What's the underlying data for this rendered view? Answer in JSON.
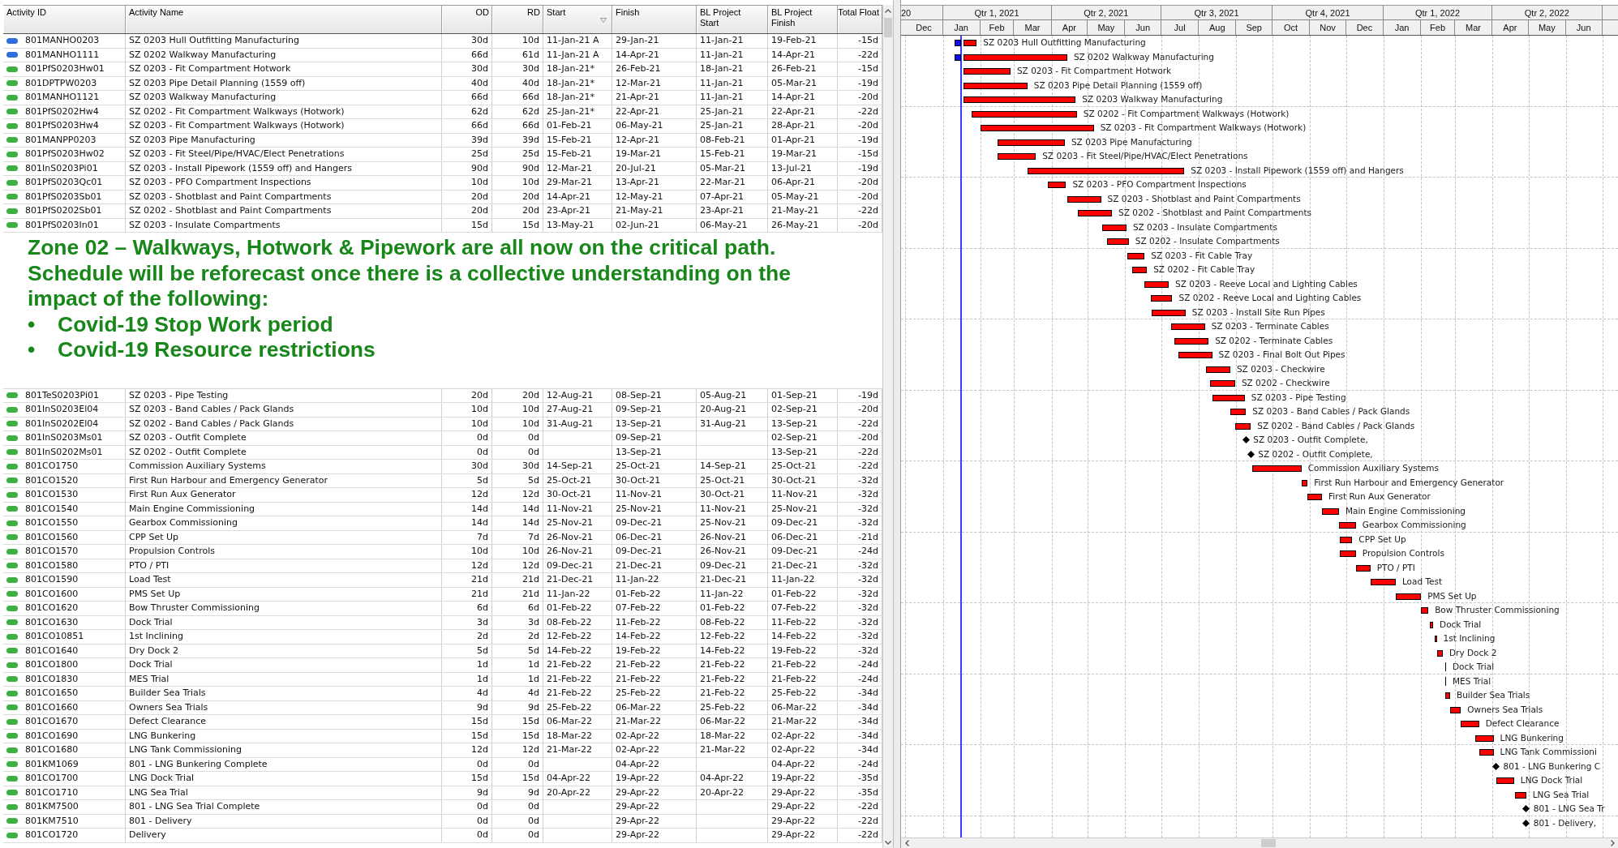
{
  "table": {
    "columns": [
      "Activity ID",
      "Activity Name",
      "OD",
      "RD",
      "Start",
      "Finish",
      "BL Project Start",
      "BL Project Finish",
      "Total Float"
    ],
    "rows_before_callout": [
      {
        "color": "#2f6fdc",
        "id": "801MANHO0203",
        "name": "SZ 0203 Hull Outfitting Manufacturing",
        "od": "30d",
        "rd": "10d",
        "start": "11-Jan-21 A",
        "finish": "29-Jan-21",
        "bl_start": "11-Jan-21",
        "bl_finish": "19-Feb-21",
        "total_float": "-15d"
      },
      {
        "color": "#2f6fdc",
        "id": "801MANHO1111",
        "name": "SZ 0202 Walkway Manufacturing",
        "od": "66d",
        "rd": "61d",
        "start": "11-Jan-21 A",
        "finish": "14-Apr-21",
        "bl_start": "11-Jan-21",
        "bl_finish": "14-Apr-21",
        "total_float": "-22d"
      },
      {
        "color": "#3cb043",
        "id": "801PfS0203Hw01",
        "name": "SZ 0203 - Fit Compartment Hotwork",
        "od": "30d",
        "rd": "30d",
        "start": "18-Jan-21*",
        "finish": "26-Feb-21",
        "bl_start": "18-Jan-21",
        "bl_finish": "26-Feb-21",
        "total_float": "-15d"
      },
      {
        "color": "#3cb043",
        "id": "801DPTPW0203",
        "name": "SZ 0203 Pipe Detail Planning (1559 off)",
        "od": "40d",
        "rd": "40d",
        "start": "18-Jan-21*",
        "finish": "12-Mar-21",
        "bl_start": "11-Jan-21",
        "bl_finish": "05-Mar-21",
        "total_float": "-19d"
      },
      {
        "color": "#3cb043",
        "id": "801MANHO1121",
        "name": "SZ 0203 Walkway Manufacturing",
        "od": "66d",
        "rd": "66d",
        "start": "18-Jan-21*",
        "finish": "21-Apr-21",
        "bl_start": "11-Jan-21",
        "bl_finish": "14-Apr-21",
        "total_float": "-20d"
      },
      {
        "color": "#3cb043",
        "id": "801PfS0202Hw4",
        "name": "SZ 0202 - Fit Compartment Walkways (Hotwork)",
        "od": "62d",
        "rd": "62d",
        "start": "25-Jan-21*",
        "finish": "22-Apr-21",
        "bl_start": "25-Jan-21",
        "bl_finish": "22-Apr-21",
        "total_float": "-22d"
      },
      {
        "color": "#3cb043",
        "id": "801PfS0203Hw4",
        "name": "SZ 0203 - Fit Compartment Walkways (Hotwork)",
        "od": "66d",
        "rd": "66d",
        "start": "01-Feb-21",
        "finish": "06-May-21",
        "bl_start": "25-Jan-21",
        "bl_finish": "28-Apr-21",
        "total_float": "-20d"
      },
      {
        "color": "#3cb043",
        "id": "801MANPP0203",
        "name": "SZ 0203 Pipe Manufacturing",
        "od": "39d",
        "rd": "39d",
        "start": "15-Feb-21",
        "finish": "12-Apr-21",
        "bl_start": "08-Feb-21",
        "bl_finish": "01-Apr-21",
        "total_float": "-19d"
      },
      {
        "color": "#3cb043",
        "id": "801PfS0203Hw02",
        "name": "SZ 0203 - Fit Steel/Pipe/HVAC/Elect Penetrations",
        "od": "25d",
        "rd": "25d",
        "start": "15-Feb-21",
        "finish": "19-Mar-21",
        "bl_start": "15-Feb-21",
        "bl_finish": "19-Mar-21",
        "total_float": "-15d"
      },
      {
        "color": "#3cb043",
        "id": "801InS0203Pi01",
        "name": "SZ 0203 - Install Pipework (1559 off) and Hangers",
        "od": "90d",
        "rd": "90d",
        "start": "12-Mar-21",
        "finish": "20-Jul-21",
        "bl_start": "05-Mar-21",
        "bl_finish": "13-Jul-21",
        "total_float": "-19d"
      },
      {
        "color": "#3cb043",
        "id": "801PfS0203Qc01",
        "name": "SZ 0203 - PFO Compartment Inspections",
        "od": "10d",
        "rd": "10d",
        "start": "29-Mar-21",
        "finish": "13-Apr-21",
        "bl_start": "22-Mar-21",
        "bl_finish": "06-Apr-21",
        "total_float": "-20d"
      },
      {
        "color": "#3cb043",
        "id": "801PfS0203Sb01",
        "name": "SZ 0203 - Shotblast and Paint Compartments",
        "od": "20d",
        "rd": "20d",
        "start": "14-Apr-21",
        "finish": "12-May-21",
        "bl_start": "07-Apr-21",
        "bl_finish": "05-May-21",
        "total_float": "-20d"
      },
      {
        "color": "#3cb043",
        "id": "801PfS0202Sb01",
        "name": "SZ 0202 - Shotblast and Paint Compartments",
        "od": "20d",
        "rd": "20d",
        "start": "23-Apr-21",
        "finish": "21-May-21",
        "bl_start": "23-Apr-21",
        "bl_finish": "21-May-21",
        "total_float": "-22d"
      },
      {
        "color": "#3cb043",
        "id": "801PfS0203In01",
        "name": "SZ 0203 - Insulate Compartments",
        "od": "15d",
        "rd": "15d",
        "start": "13-May-21",
        "finish": "02-Jun-21",
        "bl_start": "06-May-21",
        "bl_finish": "26-May-21",
        "total_float": "-20d"
      }
    ],
    "callout": {
      "text": "Zone 02 – Walkways, Hotwork & Pipework are all now on the critical path. Schedule will be reforecast once there is a collective understanding on the impact of the following:",
      "bullets": [
        {
          "marker": "•",
          "text": "Covid-19 Stop Work period"
        },
        {
          "marker": "•",
          "text": "Covid-19 Resource restrictions"
        }
      ]
    },
    "rows_after_callout": [
      {
        "color": "#3cb043",
        "id": "801TeS0203Pi01",
        "name": "SZ 0203 - Pipe Testing",
        "od": "20d",
        "rd": "20d",
        "start": "12-Aug-21",
        "finish": "08-Sep-21",
        "bl_start": "05-Aug-21",
        "bl_finish": "01-Sep-21",
        "total_float": "-19d"
      },
      {
        "color": "#3cb043",
        "id": "801InS0203El04",
        "name": "SZ 0203 - Band Cables / Pack Glands",
        "od": "10d",
        "rd": "10d",
        "start": "27-Aug-21",
        "finish": "09-Sep-21",
        "bl_start": "20-Aug-21",
        "bl_finish": "02-Sep-21",
        "total_float": "-20d"
      },
      {
        "color": "#3cb043",
        "id": "801InS0202El04",
        "name": "SZ 0202 - Band Cables / Pack Glands",
        "od": "10d",
        "rd": "10d",
        "start": "31-Aug-21",
        "finish": "13-Sep-21",
        "bl_start": "31-Aug-21",
        "bl_finish": "13-Sep-21",
        "total_float": "-22d"
      },
      {
        "color": "#3cb043",
        "id": "801InS0203Ms01",
        "name": "SZ 0203 - Outfit Complete",
        "od": "0d",
        "rd": "0d",
        "finish": "09-Sep-21",
        "bl_finish": "02-Sep-21",
        "total_float": "-20d"
      },
      {
        "color": "#3cb043",
        "id": "801InS0202Ms01",
        "name": "SZ 0202 - Outfit Complete",
        "od": "0d",
        "rd": "0d",
        "finish": "13-Sep-21",
        "bl_finish": "13-Sep-21",
        "total_float": "-22d"
      },
      {
        "color": "#3cb043",
        "id": "801CO1750",
        "name": "Commission Auxiliary Systems",
        "od": "30d",
        "rd": "30d",
        "start": "14-Sep-21",
        "finish": "25-Oct-21",
        "bl_start": "14-Sep-21",
        "bl_finish": "25-Oct-21",
        "total_float": "-22d"
      },
      {
        "color": "#3cb043",
        "id": "801CO1520",
        "name": "First Run Harbour and Emergency Generator",
        "od": "5d",
        "rd": "5d",
        "start": "25-Oct-21",
        "finish": "30-Oct-21",
        "bl_start": "25-Oct-21",
        "bl_finish": "30-Oct-21",
        "total_float": "-32d"
      },
      {
        "color": "#3cb043",
        "id": "801CO1530",
        "name": "First Run Aux Generator",
        "od": "12d",
        "rd": "12d",
        "start": "30-Oct-21",
        "finish": "11-Nov-21",
        "bl_start": "30-Oct-21",
        "bl_finish": "11-Nov-21",
        "total_float": "-32d"
      },
      {
        "color": "#3cb043",
        "id": "801CO1540",
        "name": "Main Engine Commissioning",
        "od": "14d",
        "rd": "14d",
        "start": "11-Nov-21",
        "finish": "25-Nov-21",
        "bl_start": "11-Nov-21",
        "bl_finish": "25-Nov-21",
        "total_float": "-32d"
      },
      {
        "color": "#3cb043",
        "id": "801CO1550",
        "name": "Gearbox Commissioning",
        "od": "14d",
        "rd": "14d",
        "start": "25-Nov-21",
        "finish": "09-Dec-21",
        "bl_start": "25-Nov-21",
        "bl_finish": "09-Dec-21",
        "total_float": "-32d"
      },
      {
        "color": "#3cb043",
        "id": "801CO1560",
        "name": "CPP Set Up",
        "od": "7d",
        "rd": "7d",
        "start": "26-Nov-21",
        "finish": "06-Dec-21",
        "bl_start": "26-Nov-21",
        "bl_finish": "06-Dec-21",
        "total_float": "-21d"
      },
      {
        "color": "#3cb043",
        "id": "801CO1570",
        "name": "Propulsion Controls",
        "od": "10d",
        "rd": "10d",
        "start": "26-Nov-21",
        "finish": "09-Dec-21",
        "bl_start": "26-Nov-21",
        "bl_finish": "09-Dec-21",
        "total_float": "-24d"
      },
      {
        "color": "#3cb043",
        "id": "801CO1580",
        "name": "PTO / PTI",
        "od": "12d",
        "rd": "12d",
        "start": "09-Dec-21",
        "finish": "21-Dec-21",
        "bl_start": "09-Dec-21",
        "bl_finish": "21-Dec-21",
        "total_float": "-32d"
      },
      {
        "color": "#3cb043",
        "id": "801CO1590",
        "name": "Load Test",
        "od": "21d",
        "rd": "21d",
        "start": "21-Dec-21",
        "finish": "11-Jan-22",
        "bl_start": "21-Dec-21",
        "bl_finish": "11-Jan-22",
        "total_float": "-32d"
      },
      {
        "color": "#3cb043",
        "id": "801CO1600",
        "name": "PMS Set Up",
        "od": "21d",
        "rd": "21d",
        "start": "11-Jan-22",
        "finish": "01-Feb-22",
        "bl_start": "11-Jan-22",
        "bl_finish": "01-Feb-22",
        "total_float": "-32d"
      },
      {
        "color": "#3cb043",
        "id": "801CO1620",
        "name": "Bow Thruster Commissioning",
        "od": "6d",
        "rd": "6d",
        "start": "01-Feb-22",
        "finish": "07-Feb-22",
        "bl_start": "01-Feb-22",
        "bl_finish": "07-Feb-22",
        "total_float": "-32d"
      },
      {
        "color": "#3cb043",
        "id": "801CO1630",
        "name": "Dock Trial",
        "od": "3d",
        "rd": "3d",
        "start": "08-Feb-22",
        "finish": "11-Feb-22",
        "bl_start": "08-Feb-22",
        "bl_finish": "11-Feb-22",
        "total_float": "-32d"
      },
      {
        "color": "#3cb043",
        "id": "801CO10851",
        "name": "1st Inclining",
        "od": "2d",
        "rd": "2d",
        "start": "12-Feb-22",
        "finish": "14-Feb-22",
        "bl_start": "12-Feb-22",
        "bl_finish": "14-Feb-22",
        "total_float": "-32d"
      },
      {
        "color": "#3cb043",
        "id": "801CO1640",
        "name": "Dry Dock 2",
        "od": "5d",
        "rd": "5d",
        "start": "14-Feb-22",
        "finish": "19-Feb-22",
        "bl_start": "14-Feb-22",
        "bl_finish": "19-Feb-22",
        "total_float": "-32d"
      },
      {
        "color": "#3cb043",
        "id": "801CO1800",
        "name": "Dock Trial",
        "od": "1d",
        "rd": "1d",
        "start": "21-Feb-22",
        "finish": "21-Feb-22",
        "bl_start": "21-Feb-22",
        "bl_finish": "21-Feb-22",
        "total_float": "-24d"
      },
      {
        "color": "#3cb043",
        "id": "801CO1830",
        "name": "MES Trial",
        "od": "1d",
        "rd": "1d",
        "start": "21-Feb-22",
        "finish": "21-Feb-22",
        "bl_start": "21-Feb-22",
        "bl_finish": "21-Feb-22",
        "total_float": "-24d"
      },
      {
        "color": "#3cb043",
        "id": "801CO1650",
        "name": "Builder Sea Trials",
        "od": "4d",
        "rd": "4d",
        "start": "21-Feb-22",
        "finish": "25-Feb-22",
        "bl_start": "21-Feb-22",
        "bl_finish": "25-Feb-22",
        "total_float": "-34d"
      },
      {
        "color": "#3cb043",
        "id": "801CO1660",
        "name": "Owners Sea Trials",
        "od": "9d",
        "rd": "9d",
        "start": "25-Feb-22",
        "finish": "06-Mar-22",
        "bl_start": "25-Feb-22",
        "bl_finish": "06-Mar-22",
        "total_float": "-34d"
      },
      {
        "color": "#3cb043",
        "id": "801CO1670",
        "name": "Defect Clearance",
        "od": "15d",
        "rd": "15d",
        "start": "06-Mar-22",
        "finish": "21-Mar-22",
        "bl_start": "06-Mar-22",
        "bl_finish": "21-Mar-22",
        "total_float": "-34d"
      },
      {
        "color": "#3cb043",
        "id": "801CO1690",
        "name": "LNG Bunkering",
        "od": "15d",
        "rd": "15d",
        "start": "18-Mar-22",
        "finish": "02-Apr-22",
        "bl_start": "18-Mar-22",
        "bl_finish": "02-Apr-22",
        "total_float": "-34d"
      },
      {
        "color": "#3cb043",
        "id": "801CO1680",
        "name": "LNG Tank Commissioning",
        "od": "12d",
        "rd": "12d",
        "start": "21-Mar-22",
        "finish": "02-Apr-22",
        "bl_start": "21-Mar-22",
        "bl_finish": "02-Apr-22",
        "total_float": "-34d"
      },
      {
        "color": "#3cb043",
        "id": "801KM1069",
        "name": "801 - LNG Bunkering Complete",
        "od": "0d",
        "rd": "0d",
        "finish": "04-Apr-22",
        "bl_finish": "04-Apr-22",
        "total_float": "-24d"
      },
      {
        "color": "#3cb043",
        "id": "801CO1700",
        "name": "LNG Dock Trial",
        "od": "15d",
        "rd": "15d",
        "start": "04-Apr-22",
        "finish": "19-Apr-22",
        "bl_start": "04-Apr-22",
        "bl_finish": "19-Apr-22",
        "total_float": "-35d"
      },
      {
        "color": "#3cb043",
        "id": "801CO1710",
        "name": "LNG Sea Trial",
        "od": "9d",
        "rd": "9d",
        "start": "20-Apr-22",
        "finish": "29-Apr-22",
        "bl_start": "20-Apr-22",
        "bl_finish": "29-Apr-22",
        "total_float": "-35d"
      },
      {
        "color": "#3cb043",
        "id": "801KM7500",
        "name": "801 - LNG Sea Trial Complete",
        "od": "0d",
        "rd": "0d",
        "finish": "29-Apr-22",
        "bl_finish": "29-Apr-22",
        "total_float": "-22d"
      },
      {
        "color": "#3cb043",
        "id": "801KM7510",
        "name": "801 - Delivery",
        "od": "0d",
        "rd": "0d",
        "finish": "29-Apr-22",
        "bl_finish": "29-Apr-22",
        "total_float": "-22d"
      },
      {
        "color": "#3cb043",
        "id": "801CO1720",
        "name": "Delivery",
        "od": "0d",
        "rd": "0d",
        "finish": "29-Apr-22",
        "bl_finish": "29-Apr-22",
        "total_float": "-22d"
      }
    ]
  },
  "gantt": {
    "quarters": [
      "20",
      "Qtr 1, 2021",
      "Qtr 2, 2021",
      "Qtr 3, 2021",
      "Qtr 4, 2021",
      "Qtr 1, 2022",
      "Qtr 2, 2022"
    ],
    "months": [
      "Dec",
      "Jan",
      "Feb",
      "Mar",
      "Apr",
      "May",
      "Jun",
      "Jul",
      "Aug",
      "Sep",
      "Oct",
      "Nov",
      "Dec",
      "Jan",
      "Feb",
      "Mar",
      "Apr",
      "May",
      "Jun"
    ],
    "rows": [
      {
        "kind": "bar",
        "started": true,
        "label": "SZ 0203 Hull Outfitting Manufacturing"
      },
      {
        "kind": "bar",
        "started": true,
        "label": "SZ 0202 Walkway Manufacturing"
      },
      {
        "kind": "bar",
        "started": false,
        "label": "SZ 0203 - Fit Compartment Hotwork"
      },
      {
        "kind": "bar",
        "started": false,
        "label": "SZ 0203 Pipe Detail Planning (1559 off)"
      },
      {
        "kind": "bar",
        "started": false,
        "label": "SZ 0203 Walkway Manufacturing"
      },
      {
        "kind": "bar",
        "started": false,
        "label": "SZ 0202 - Fit Compartment Walkways (Hotwork)"
      },
      {
        "kind": "bar",
        "started": false,
        "label": "SZ 0203 - Fit Compartment Walkways (Hotwork)"
      },
      {
        "kind": "bar",
        "started": false,
        "label": "SZ 0203 Pipe Manufacturing"
      },
      {
        "kind": "bar",
        "started": false,
        "label": "SZ 0203 - Fit Steel/Pipe/HVAC/Elect Penetrations"
      },
      {
        "kind": "bar",
        "started": false,
        "label": "SZ 0203 - Install Pipework (1559 off) and Hangers"
      },
      {
        "kind": "bar",
        "started": false,
        "label": "SZ 0203 - PFO Compartment Inspections"
      },
      {
        "kind": "bar",
        "started": false,
        "label": "SZ 0203 - Shotblast and Paint Compartments"
      },
      {
        "kind": "bar",
        "started": false,
        "label": "SZ 0202 - Shotblast and Paint Compartments"
      },
      {
        "kind": "bar",
        "started": false,
        "label": "SZ 0203 - Insulate Compartments"
      },
      {
        "kind": "bar",
        "started": false,
        "label": "SZ 0202 - Insulate Compartments"
      },
      {
        "kind": "bar",
        "started": false,
        "label": "SZ 0203 - Fit Cable Tray"
      },
      {
        "kind": "bar",
        "started": false,
        "label": "SZ 0202 - Fit Cable Tray"
      },
      {
        "kind": "bar",
        "started": false,
        "label": "SZ 0203 - Reeve Local and Lighting Cables"
      },
      {
        "kind": "bar",
        "started": false,
        "label": "SZ 0202 - Reeve Local and Lighting Cables"
      },
      {
        "kind": "bar",
        "started": false,
        "label": "SZ 0203 - Install Site Run Pipes"
      },
      {
        "kind": "bar",
        "started": false,
        "label": "SZ 0203 - Terminate Cables"
      },
      {
        "kind": "bar",
        "started": false,
        "label": "SZ 0202 - Terminate Cables"
      },
      {
        "kind": "bar",
        "started": false,
        "label": "SZ 0203 - Final Bolt Out Pipes"
      },
      {
        "kind": "bar",
        "started": false,
        "label": "SZ 0203 - Checkwire"
      },
      {
        "kind": "bar",
        "started": false,
        "label": "SZ 0202 - Checkwire"
      },
      {
        "kind": "bar",
        "started": false,
        "label": "SZ 0203 - Pipe Testing"
      },
      {
        "kind": "bar",
        "started": false,
        "label": "SZ 0203 - Band Cables / Pack Glands"
      },
      {
        "kind": "bar",
        "started": false,
        "label": "SZ 0202 - Band Cables / Pack Glands"
      },
      {
        "kind": "milestone",
        "started": false,
        "label": "SZ 0203 - Outfit Complete,"
      },
      {
        "kind": "milestone",
        "started": false,
        "label": "SZ 0202 - Outfit Complete,"
      },
      {
        "kind": "bar",
        "started": false,
        "label": "Commission Auxiliary Systems"
      },
      {
        "kind": "bar",
        "started": false,
        "label": "First Run Harbour and Emergency Generator"
      },
      {
        "kind": "bar",
        "started": false,
        "label": "First Run Aux Generator"
      },
      {
        "kind": "bar",
        "started": false,
        "label": "Main Engine Commissioning"
      },
      {
        "kind": "bar",
        "started": false,
        "label": "Gearbox Commissioning"
      },
      {
        "kind": "bar",
        "started": false,
        "label": "CPP Set Up"
      },
      {
        "kind": "bar",
        "started": false,
        "label": "Propulsion Controls"
      },
      {
        "kind": "bar",
        "started": false,
        "label": "PTO / PTI"
      },
      {
        "kind": "bar",
        "started": false,
        "label": "Load Test"
      },
      {
        "kind": "bar",
        "started": false,
        "label": "PMS Set Up"
      },
      {
        "kind": "bar",
        "started": false,
        "label": "Bow Thruster Commissioning"
      },
      {
        "kind": "bar",
        "started": false,
        "label": "Dock Trial"
      },
      {
        "kind": "bar",
        "started": false,
        "label": "1st Inclining"
      },
      {
        "kind": "bar",
        "started": false,
        "label": "Dry Dock 2"
      },
      {
        "kind": "bar",
        "started": false,
        "label": "Dock Trial"
      },
      {
        "kind": "bar",
        "started": false,
        "label": "MES Trial"
      },
      {
        "kind": "bar",
        "started": false,
        "label": "Builder Sea Trials"
      },
      {
        "kind": "bar",
        "started": false,
        "label": "Owners Sea Trials"
      },
      {
        "kind": "bar",
        "started": false,
        "label": "Defect Clearance"
      },
      {
        "kind": "bar",
        "started": false,
        "label": "LNG Bunkering"
      },
      {
        "kind": "bar",
        "started": false,
        "label": "LNG Tank Commissioni"
      },
      {
        "kind": "milestone",
        "started": false,
        "label": "801 - LNG Bunkering C"
      },
      {
        "kind": "bar",
        "started": false,
        "label": "LNG Dock Trial"
      },
      {
        "kind": "bar",
        "started": false,
        "label": "LNG Sea Trial"
      },
      {
        "kind": "milestone",
        "started": false,
        "label": "801 - LNG Sea Tr"
      },
      {
        "kind": "milestone",
        "started": false,
        "label": "801 - Delivery,"
      }
    ]
  }
}
